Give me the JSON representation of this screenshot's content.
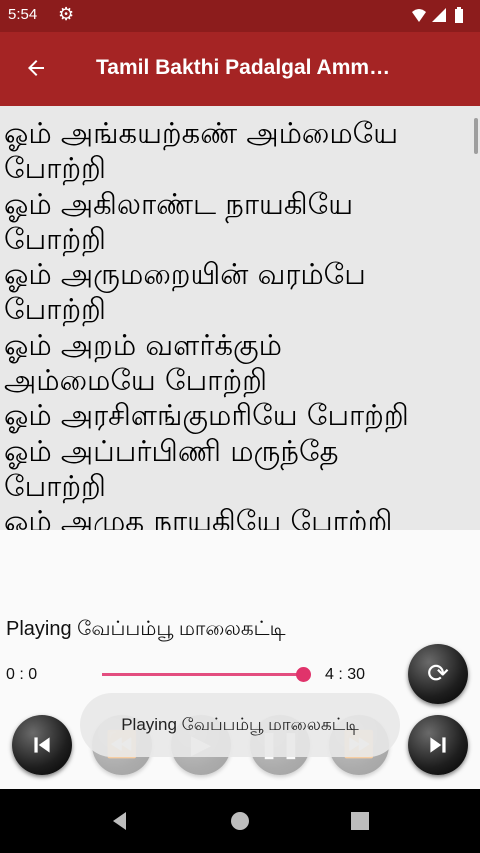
{
  "status_bar": {
    "time": "5:54",
    "settings_icon": "gear-icon",
    "status_icons": "wifi-icon signal-icon battery-icon"
  },
  "app_bar": {
    "title": "Tamil Bakthi Padalgal Amm…",
    "back_icon": "arrow-left-icon"
  },
  "lyrics": {
    "text": "ஓம் அங்கயற்கண் அம்மையே\nபோற்றி\nஓம் அகிலாண்ட நாயகியே\nபோற்றி\nஓம் அருமறையின் வரம்பே\nபோற்றி\nஓம் அறம் வளர்க்கும்\nஅம்மையே போற்றி\nஓம் அரசிளங்குமரியே போற்றி\nஓம் அப்பர்பிணி மருந்தே\nபோற்றி\nஓம் அமுத நாயகியே போற்றி"
  },
  "player": {
    "now_playing": "Playing வேப்பம்பூ மாலைகட்டி",
    "time_elapsed": "0 : 0",
    "time_total": "4 : 30",
    "progress": 1.0,
    "accent_color": "#e0336b",
    "toast": "Playing வேப்பம்பூ மாலைகட்டி",
    "controls": [
      "repeat-icon",
      "skip-previous-icon",
      "rewind-icon",
      "play-icon",
      "pause-icon",
      "fast-forward-icon",
      "skip-next-icon"
    ]
  },
  "colors": {
    "status_bar": "#8c1c1c",
    "app_bar": "#a52424",
    "lyrics_bg": "#e8e8e8"
  }
}
